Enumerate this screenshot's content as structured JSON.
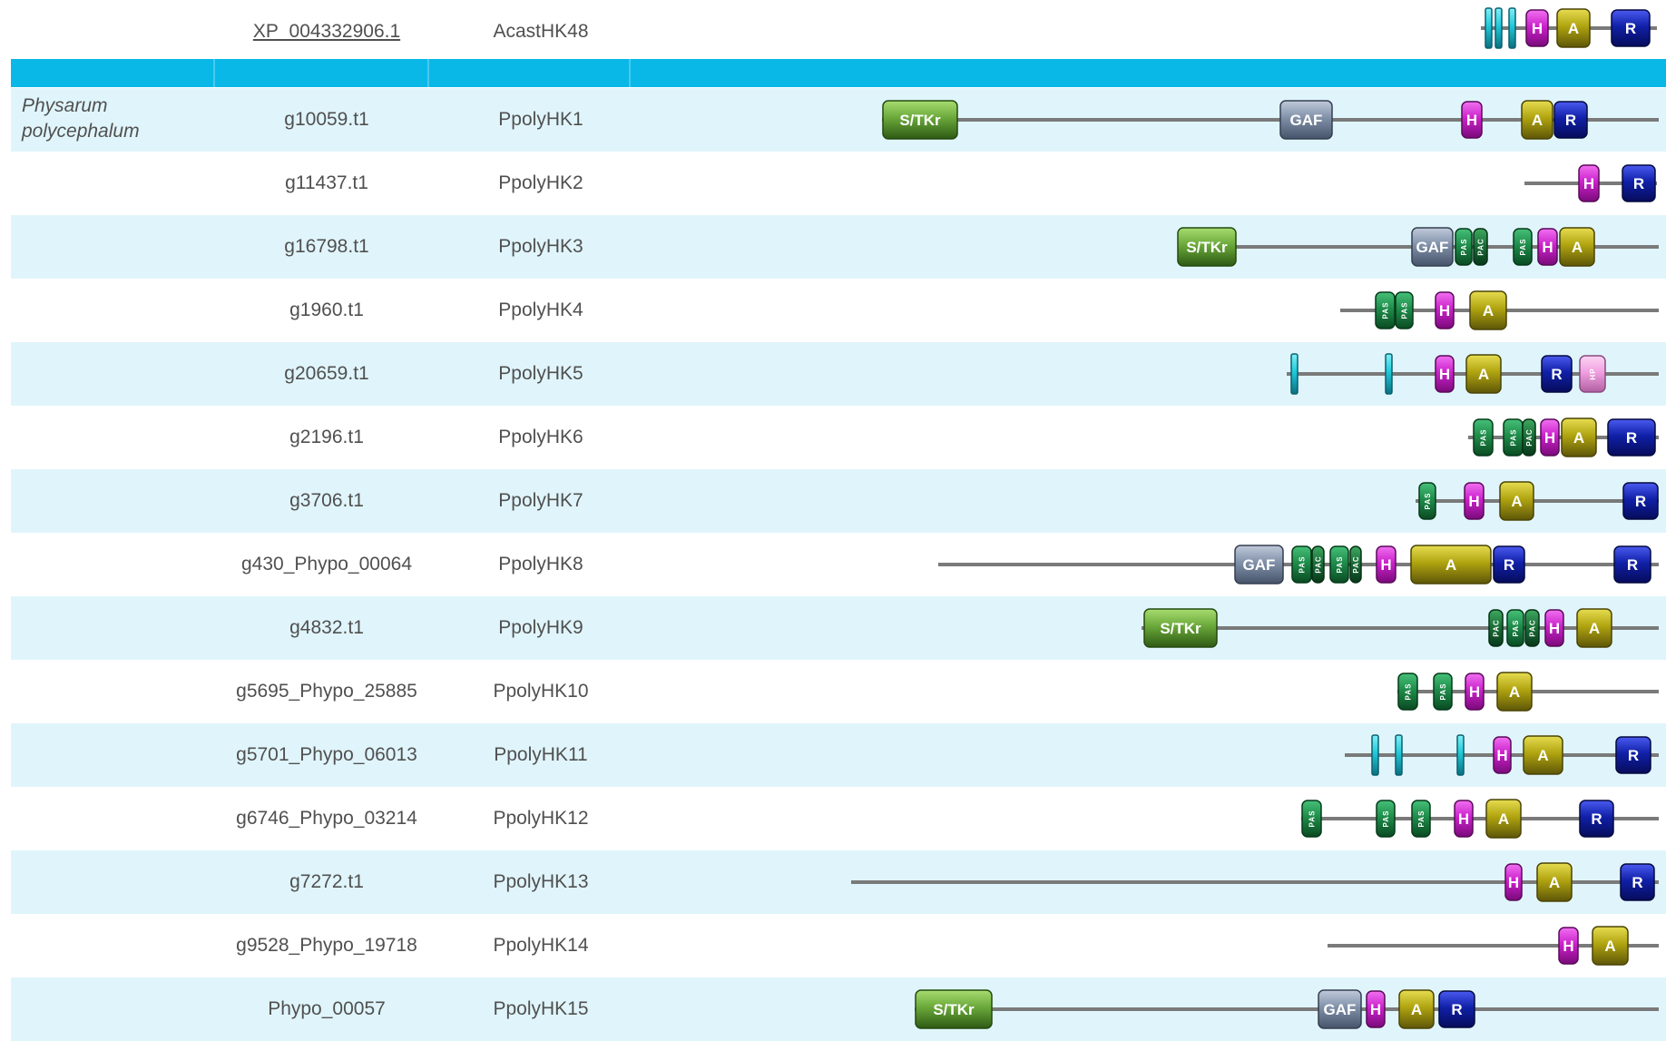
{
  "columns": {
    "gene_id": "",
    "protein_name": "",
    "species": "",
    "architecture": ""
  },
  "colors": {
    "header_band": "#0ab8e8",
    "row_shade": "#e0f5fb",
    "backbone": "#7a7a7a",
    "domain_H": "#cc22cc",
    "domain_A": "#b0a410",
    "domain_R": "#1020a8",
    "domain_GAF": "#8090a8",
    "domain_STKr": "#6aa83a",
    "domain_PAS": "#1e8c4a",
    "domain_TM": "#20c8d8",
    "domain_HP": "#f0a0e0"
  },
  "legend_labels": {
    "H": "H",
    "A": "A",
    "R": "R",
    "GAF": "GAF",
    "STKr": "S/TKr",
    "PAS": "PAS",
    "PAC": "PAC",
    "HP": "HP"
  },
  "top_row": {
    "accession": "XP_004332906.1",
    "name": "AcastHK48",
    "species": "",
    "domains": [
      "TM",
      "TM",
      "TM",
      "H",
      "A",
      "R"
    ]
  },
  "species_label": "Physarum polycephalum",
  "rows": [
    {
      "accession": "g10059.t1",
      "name": "PpolyHK1",
      "domains": [
        "STKr",
        "GAF",
        "H",
        "A",
        "R"
      ]
    },
    {
      "accession": "g11437.t1",
      "name": "PpolyHK2",
      "domains": [
        "H",
        "R"
      ]
    },
    {
      "accession": "g16798.t1",
      "name": "PpolyHK3",
      "domains": [
        "STKr",
        "GAF",
        "PAS",
        "PAC",
        "PAS",
        "H",
        "A"
      ]
    },
    {
      "accession": "g1960.t1",
      "name": "PpolyHK4",
      "domains": [
        "PAS",
        "PAS",
        "H",
        "A"
      ]
    },
    {
      "accession": "g20659.t1",
      "name": "PpolyHK5",
      "domains": [
        "TM",
        "TM",
        "H",
        "A",
        "R",
        "HP"
      ]
    },
    {
      "accession": "g2196.t1",
      "name": "PpolyHK6",
      "domains": [
        "PAS",
        "PAS",
        "PAC",
        "H",
        "A",
        "R"
      ]
    },
    {
      "accession": "g3706.t1",
      "name": "PpolyHK7",
      "domains": [
        "PAS",
        "H",
        "A",
        "R"
      ]
    },
    {
      "accession": "g430_Phypo_00064",
      "name": "PpolyHK8",
      "domains": [
        "GAF",
        "PAS",
        "PAC",
        "PAS",
        "PAC",
        "H",
        "A",
        "R",
        "R"
      ]
    },
    {
      "accession": "g4832.t1",
      "name": "PpolyHK9",
      "domains": [
        "STKr",
        "PAC",
        "PAS",
        "PAC",
        "H",
        "A"
      ]
    },
    {
      "accession": "g5695_Phypo_25885",
      "name": "PpolyHK10",
      "domains": [
        "PAS",
        "PAS",
        "H",
        "A"
      ]
    },
    {
      "accession": "g5701_Phypo_06013",
      "name": "PpolyHK11",
      "domains": [
        "TM",
        "TM",
        "TM",
        "H",
        "A",
        "R"
      ]
    },
    {
      "accession": "g6746_Phypo_03214",
      "name": "PpolyHK12",
      "domains": [
        "PAS",
        "PAS",
        "PAS",
        "H",
        "A",
        "R"
      ]
    },
    {
      "accession": "g7272.t1",
      "name": "PpolyHK13",
      "domains": [
        "H",
        "A",
        "R"
      ]
    },
    {
      "accession": "g9528_Phypo_19718",
      "name": "PpolyHK14",
      "domains": [
        "H",
        "A"
      ]
    },
    {
      "accession": "Phypo_00057",
      "name": "PpolyHK15",
      "domains": [
        "STKr",
        "GAF",
        "H",
        "A",
        "R"
      ]
    }
  ]
}
